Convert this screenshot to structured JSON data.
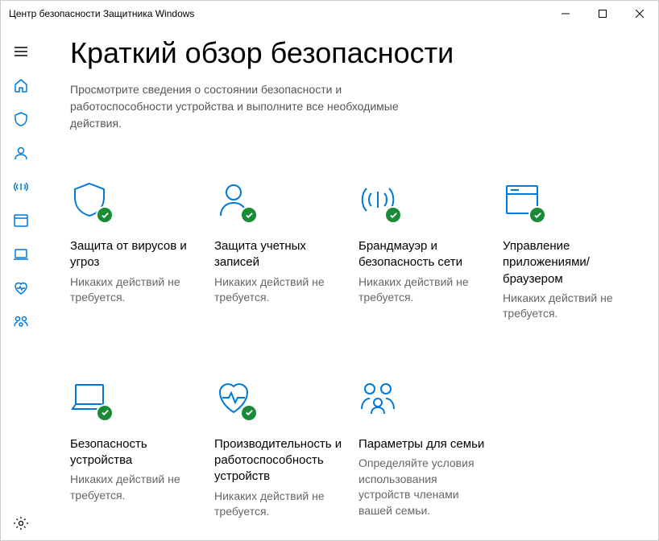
{
  "window": {
    "title": "Центр безопасности Защитника Windows"
  },
  "page": {
    "title": "Краткий обзор безопасности",
    "subtitle": "Просмотрите сведения о состоянии безопасности и работоспособности устройства и выполните все необходимые действия."
  },
  "tiles": {
    "virus": {
      "title": "Защита от вирусов и угроз",
      "status": "Никаких действий не требуется."
    },
    "account": {
      "title": "Защита учетных записей",
      "status": "Никаких действий не требуется."
    },
    "firewall": {
      "title": "Брандмауэр и безопасность сети",
      "status": "Никаких действий не требуется."
    },
    "appbrowser": {
      "title": "Управление приложениями/браузером",
      "status": "Никаких действий не требуется."
    },
    "device": {
      "title": "Безопасность устройства",
      "status": "Никаких действий не требуется."
    },
    "health": {
      "title": "Производительность и работоспособность устройств",
      "status": "Никаких действий не требуется."
    },
    "family": {
      "title": "Параметры для семьи",
      "status": "Определяйте условия использования устройств членами вашей семьи."
    }
  }
}
